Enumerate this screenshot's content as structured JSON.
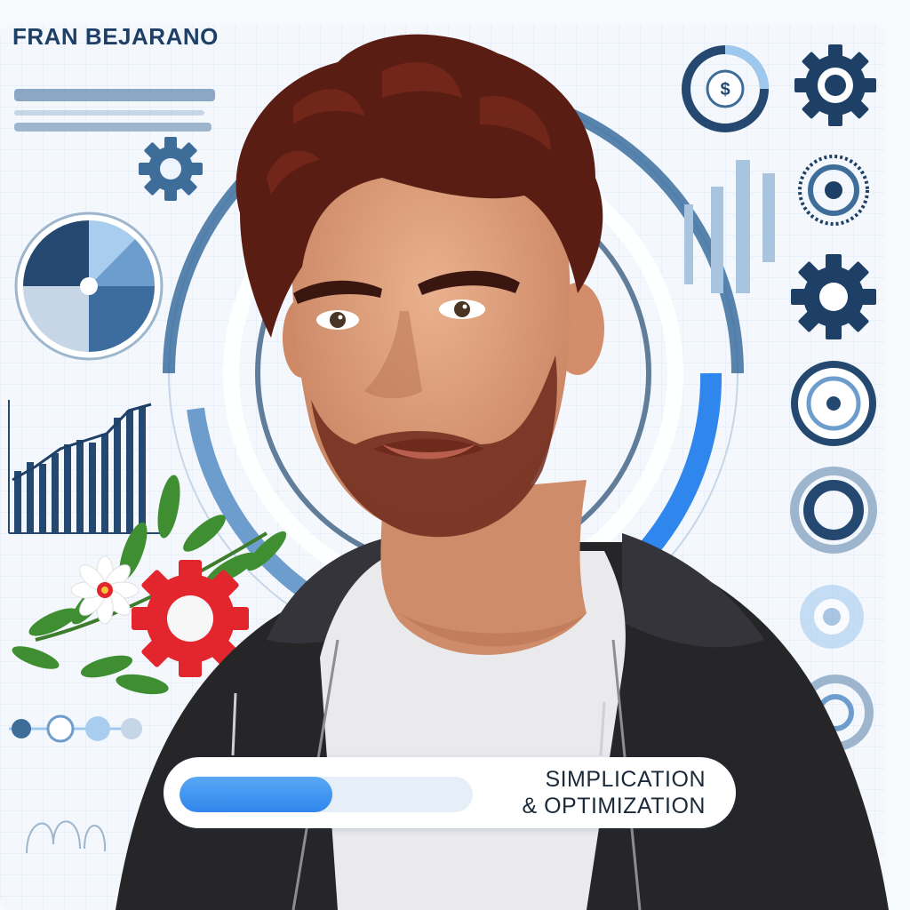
{
  "title": "FRAN BEJARANO",
  "badge": {
    "line1": "SIMPLICATION",
    "line2": "& OPTIMIZATION",
    "progress": 0.52
  },
  "colors": {
    "navy": "#1e3f66",
    "accent_blue": "#2f86ec",
    "light_blue": "#9fc8ee",
    "grid": "#d6e4f2",
    "gear_red": "#e3262e",
    "hair": "#5a1d14",
    "skin": "#e0a080",
    "hoodie": "#262629",
    "tshirt": "#eaeaec"
  },
  "icons": [
    "gear-icon",
    "pie-chart-icon",
    "bar-chart-icon",
    "target-ring-icon",
    "red-gear-icon",
    "flower-icon",
    "leaf-branch-icon",
    "dollar-ring-icon"
  ]
}
